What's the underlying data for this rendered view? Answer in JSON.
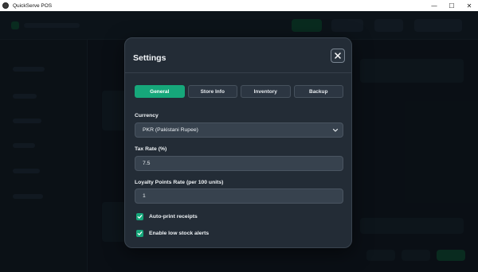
{
  "window": {
    "title": "QuickServe POS",
    "controls": {
      "minimize": "—",
      "maximize": "☐",
      "close": "✕"
    }
  },
  "settings_modal": {
    "title": "Settings",
    "close_icon": "close-icon",
    "tabs": [
      {
        "label": "General",
        "active": true
      },
      {
        "label": "Store Info",
        "active": false
      },
      {
        "label": "Inventory",
        "active": false
      },
      {
        "label": "Backup",
        "active": false
      }
    ],
    "currency": {
      "label": "Currency",
      "value": "PKR (Pakistani Rupee)"
    },
    "tax_rate": {
      "label": "Tax Rate (%)",
      "value": "7.5"
    },
    "loyalty_rate": {
      "label": "Loyalty Points Rate (per 100 units)",
      "value": "1"
    },
    "checkboxes": [
      {
        "label": "Auto-print receipts",
        "checked": true
      },
      {
        "label": "Enable low stock alerts",
        "checked": true
      }
    ]
  },
  "colors": {
    "accent": "#16a77a",
    "modal_bg": "#232c36",
    "field_bg": "#37424e",
    "app_bg": "#0e151c"
  }
}
